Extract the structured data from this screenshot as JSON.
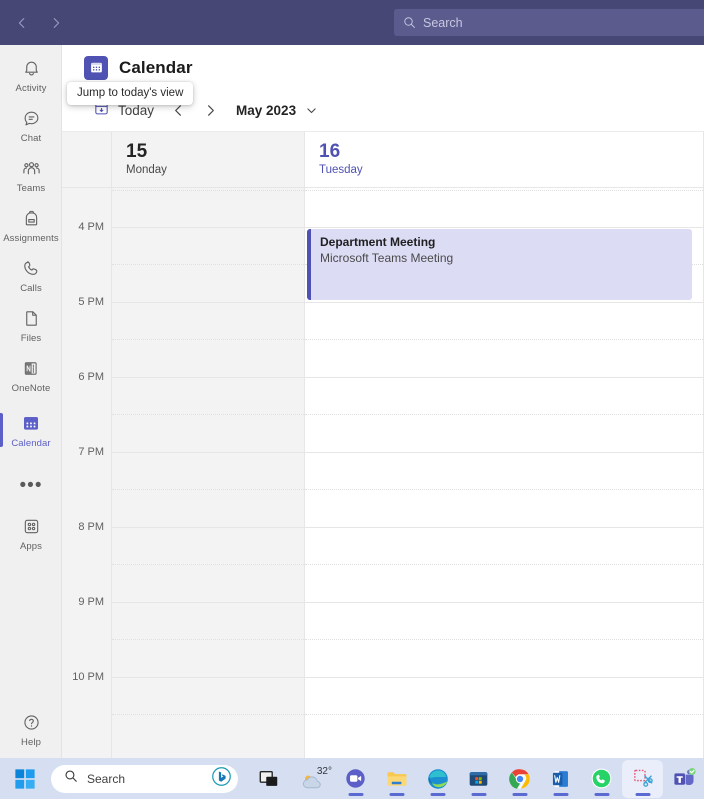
{
  "titlebar": {
    "back_icon": "chevron-left-icon",
    "forward_icon": "chevron-right-icon",
    "search_placeholder": "Search",
    "search_icon": "search-icon",
    "bg_color": "#464775"
  },
  "rail": {
    "items": [
      {
        "label": "Activity",
        "icon": "bell-icon",
        "active": false
      },
      {
        "label": "Chat",
        "icon": "chat-bubble-icon",
        "active": false
      },
      {
        "label": "Teams",
        "icon": "people-icon",
        "active": false
      },
      {
        "label": "Assignments",
        "icon": "backpack-icon",
        "active": false
      },
      {
        "label": "Calls",
        "icon": "phone-icon",
        "active": false
      },
      {
        "label": "Files",
        "icon": "document-icon",
        "active": false
      },
      {
        "label": "OneNote",
        "icon": "onenote-icon",
        "active": false
      },
      {
        "label": "Calendar",
        "icon": "calendar-icon",
        "active": true
      },
      {
        "label": "",
        "icon": "more-options-icon",
        "active": false
      },
      {
        "label": "Apps",
        "icon": "apps-grid-icon",
        "active": false
      }
    ],
    "help": {
      "label": "Help",
      "icon": "question-circle-icon"
    },
    "accent_color": "#5b5fc7"
  },
  "app": {
    "title": "Calendar",
    "icon": "calendar-app-icon",
    "tooltip": "Jump to today's view"
  },
  "toolbar": {
    "today_label": "Today",
    "today_icon": "today-calendar-icon",
    "prev_icon": "chevron-left-icon",
    "next_icon": "chevron-right-icon",
    "month_label": "May 2023",
    "month_chevron_icon": "chevron-down-icon"
  },
  "calendar": {
    "days": [
      {
        "number": "15",
        "name": "Monday",
        "today": false
      },
      {
        "number": "16",
        "name": "Tuesday",
        "today": true
      }
    ],
    "time_labels": [
      "4 PM",
      "5 PM",
      "6 PM",
      "7 PM",
      "8 PM",
      "9 PM",
      "10 PM"
    ],
    "events": [
      {
        "title": "Department Meeting",
        "subtitle": "Microsoft Teams Meeting",
        "day_index": 1,
        "start": "4 PM",
        "end": "5 PM",
        "bg_color": "#dcdcf5",
        "accent_color": "#4f52b2"
      }
    ]
  },
  "taskbar": {
    "start_icon": "windows-start-icon",
    "search_label": "Search",
    "search_icon": "search-icon",
    "bing_icon": "bing-copilot-icon",
    "weather_temp": "32°",
    "weather_icon": "cloud-icon",
    "items": [
      {
        "name": "task-view-icon",
        "label": "Task View"
      },
      {
        "name": "weather-widget",
        "label": "32°"
      },
      {
        "name": "meet-now-icon",
        "label": "Meet Now"
      },
      {
        "name": "file-explorer-icon",
        "label": "File Explorer"
      },
      {
        "name": "edge-icon",
        "label": "Microsoft Edge"
      },
      {
        "name": "microsoft-store-icon",
        "label": "Microsoft Store"
      },
      {
        "name": "chrome-icon",
        "label": "Google Chrome"
      },
      {
        "name": "word-icon",
        "label": "Microsoft Word"
      },
      {
        "name": "whatsapp-icon",
        "label": "WhatsApp"
      },
      {
        "name": "snipping-tool-icon",
        "label": "Snipping Tool"
      },
      {
        "name": "teams-icon",
        "label": "Microsoft Teams"
      }
    ]
  }
}
